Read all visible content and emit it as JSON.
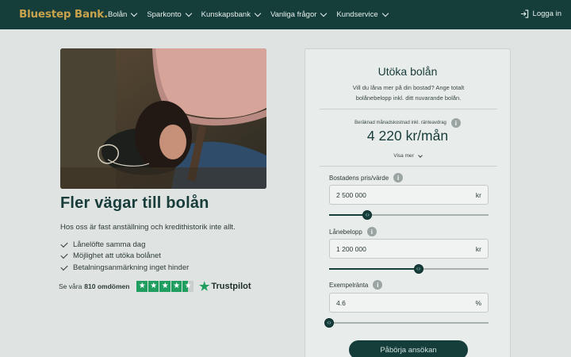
{
  "header": {
    "logo": "Bluestep Bank.",
    "nav": [
      {
        "label": "Bolån",
        "name": "nav-bolan"
      },
      {
        "label": "Sparkonto",
        "name": "nav-sparkonto"
      },
      {
        "label": "Kunskapsbank",
        "name": "nav-kunskapsbank"
      },
      {
        "label": "Vanliga frågor",
        "name": "nav-vanliga-fragor"
      },
      {
        "label": "Kundservice",
        "name": "nav-kundservice"
      }
    ],
    "login_label": "Logga in"
  },
  "hero": {
    "title": "Fler vägar till bolån",
    "subtitle": "Hos oss är fast anställning och kredithistorik inte allt.",
    "usps": [
      "Lånelöfte samma dag",
      "Möjlighet att utöka bolånet",
      "Betalningsanmärkning inget hinder"
    ]
  },
  "trustpilot": {
    "prefix": "Se våra",
    "count": "810 omdömen",
    "rating_stars": 4.5,
    "brand": "Trustpilot"
  },
  "calculator": {
    "title": "Utöka bolån",
    "description": "Vill du låna mer på din bostad? Ange totalt bolånebelopp inkl. ditt nuvarande bolån.",
    "estimate_label": "Beräknad månadskostnad inkl. ränteavdrag",
    "estimate_value": "4 220 kr/mån",
    "show_more": "Visa mer",
    "fields": [
      {
        "label": "Bostadens pris/värde",
        "value": "2 500 000",
        "unit": "kr",
        "slider_fraction": 0.24
      },
      {
        "label": "Lånebelopp",
        "value": "1 200 000",
        "unit": "kr",
        "slider_fraction": 0.56
      },
      {
        "label": "Exempelränta",
        "value": "4.6",
        "unit": "%",
        "slider_fraction": 0.0
      }
    ],
    "cta_label": "Påbörja ansökan"
  },
  "colors": {
    "header_bg": "#153e3b",
    "logo": "#c9a24d",
    "accent": "#153e3b",
    "trustpilot_green": "#1f9e5f"
  }
}
